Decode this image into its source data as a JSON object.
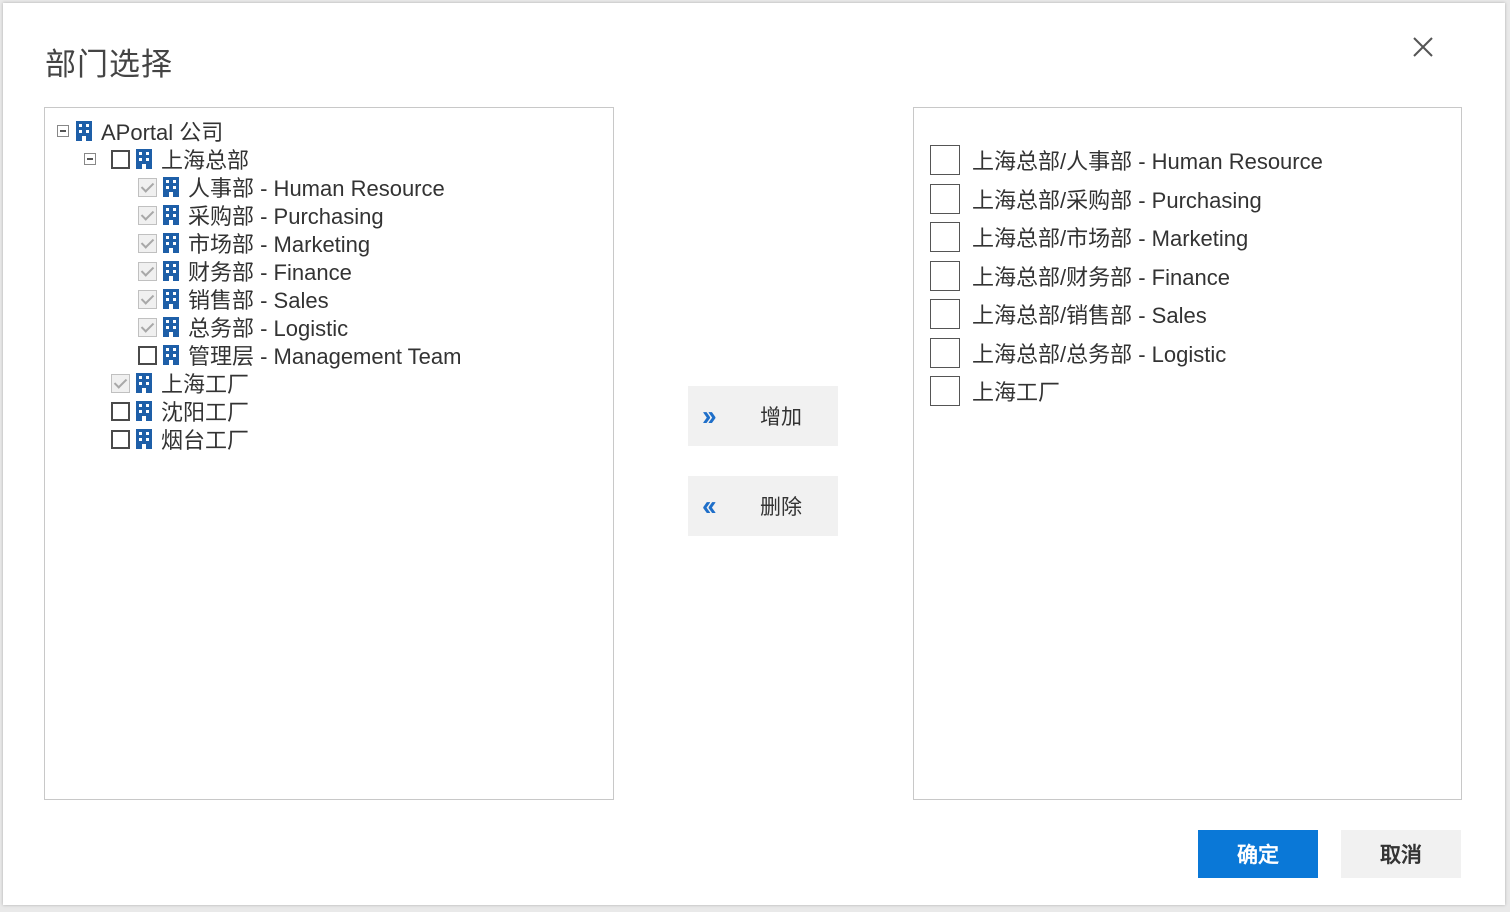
{
  "dialog": {
    "title": "部门选择",
    "close_label": "×"
  },
  "tree": {
    "root": {
      "label": "APortal 公司",
      "expanded": true
    },
    "hq": {
      "label": "上海总部",
      "expanded": true,
      "checked": false
    },
    "hq_children": [
      {
        "label": "人事部 - Human Resource",
        "state": "disabled-checked"
      },
      {
        "label": "采购部 - Purchasing",
        "state": "disabled-checked"
      },
      {
        "label": "市场部 - Marketing",
        "state": "disabled-checked"
      },
      {
        "label": "财务部 - Finance",
        "state": "disabled-checked"
      },
      {
        "label": "销售部 - Sales",
        "state": "disabled-checked"
      },
      {
        "label": "总务部 - Logistic",
        "state": "disabled-checked"
      },
      {
        "label": "管理层 - Management Team",
        "state": "unchecked"
      }
    ],
    "sites": [
      {
        "label": "上海工厂",
        "state": "disabled-checked"
      },
      {
        "label": "沈阳工厂",
        "state": "unchecked"
      },
      {
        "label": "烟台工厂",
        "state": "unchecked"
      }
    ]
  },
  "actions": {
    "add_label": "增加",
    "add_arrow": "››",
    "remove_label": "删除",
    "remove_arrow": "‹‹"
  },
  "selected": [
    {
      "label": "上海总部/人事部 - Human Resource",
      "checked": false
    },
    {
      "label": "上海总部/采购部 - Purchasing",
      "checked": false
    },
    {
      "label": "上海总部/市场部 - Marketing",
      "checked": false
    },
    {
      "label": "上海总部/财务部 - Finance",
      "checked": false
    },
    {
      "label": "上海总部/销售部 - Sales",
      "checked": false
    },
    {
      "label": "上海总部/总务部 - Logistic",
      "checked": false
    },
    {
      "label": "上海工厂",
      "checked": false
    }
  ],
  "footer": {
    "ok_label": "确定",
    "cancel_label": "取消"
  },
  "colors": {
    "primary": "#0a78d7",
    "icon_blue": "#1e5fa8",
    "arrow_blue": "#1f6fc9"
  },
  "icons": {
    "tree_node": "building-icon",
    "expand": "minus-box-icon",
    "close": "close-icon"
  }
}
